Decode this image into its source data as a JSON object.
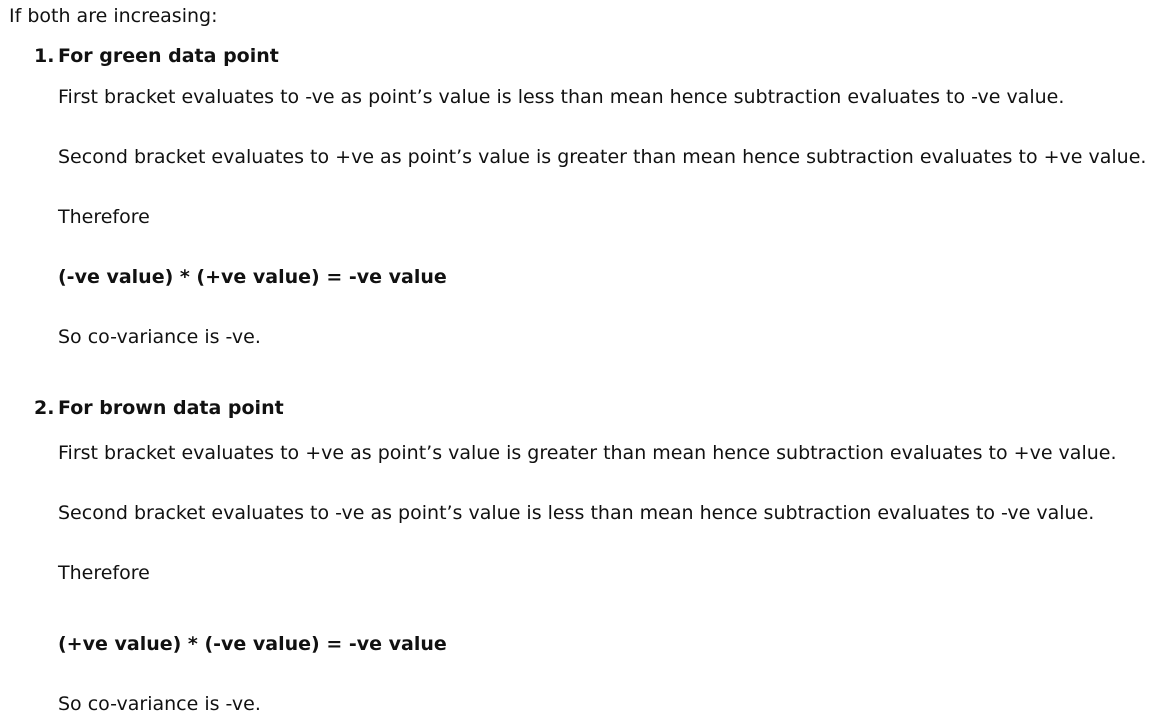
{
  "intro": "If both are increasing:",
  "sections": [
    {
      "number": "1.",
      "heading": "For green data point",
      "first_bracket": "First bracket evaluates to -ve as point’s value is less than mean hence subtraction evaluates to -ve value.",
      "second_bracket": "Second bracket evaluates to +ve as point’s value is greater than mean hence subtraction evaluates to +ve value.",
      "therefore": "Therefore",
      "equation": "(-ve value) * (+ve value) = -ve value",
      "conclusion": "So co-variance is -ve."
    },
    {
      "number": "2.",
      "heading": "For brown data point",
      "first_bracket": "First bracket evaluates to +ve as point’s value is greater than mean hence subtraction evaluates to +ve value.",
      "second_bracket": "Second bracket evaluates to -ve as point’s value is less than mean hence subtraction evaluates to -ve value.",
      "therefore": "Therefore",
      "equation": "(+ve value) * (-ve value) = -ve value",
      "conclusion": "So co-variance is -ve."
    }
  ]
}
